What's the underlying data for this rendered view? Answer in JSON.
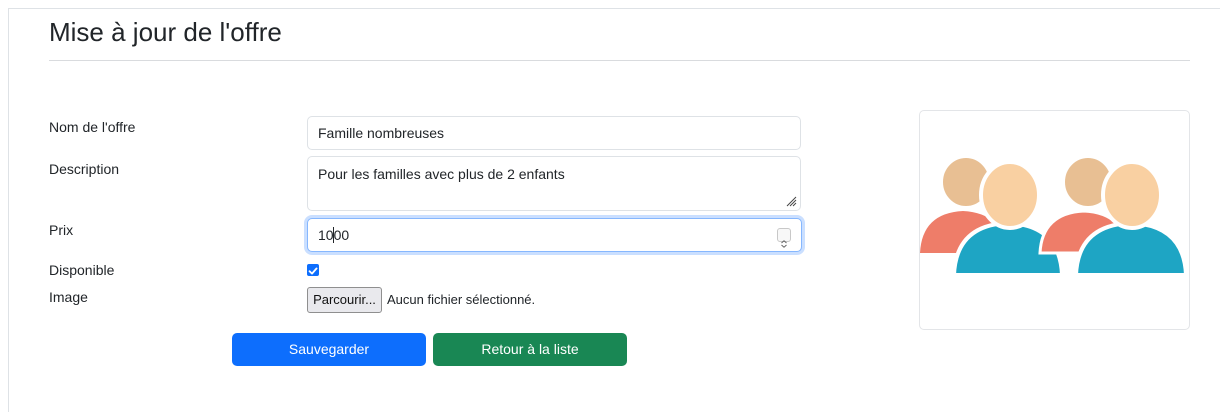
{
  "page": {
    "title": "Mise à jour de l'offre"
  },
  "form": {
    "name_label": "Nom de l'offre",
    "name_value": "Famille nombreuses",
    "description_label": "Description",
    "description_value": "Pour les familles avec plus de 2 enfants",
    "price_label": "Prix",
    "price_value_before_caret": "10",
    "price_value_after_caret": "00",
    "available_label": "Disponible",
    "available_checked": true,
    "image_label": "Image",
    "file_button_label": "Parcourir...",
    "file_status": "Aucun fichier sélectionné."
  },
  "actions": {
    "save_label": "Sauvegarder",
    "back_label": "Retour à la liste"
  },
  "preview": {
    "icon": "family-group-icon"
  },
  "colors": {
    "primary": "#0d6efd",
    "success": "#198754",
    "person_back_head": "#e8bf93",
    "person_back_body": "#ee7d69",
    "person_front_head": "#f9d0a2",
    "person_front_body": "#1ea5c4"
  }
}
